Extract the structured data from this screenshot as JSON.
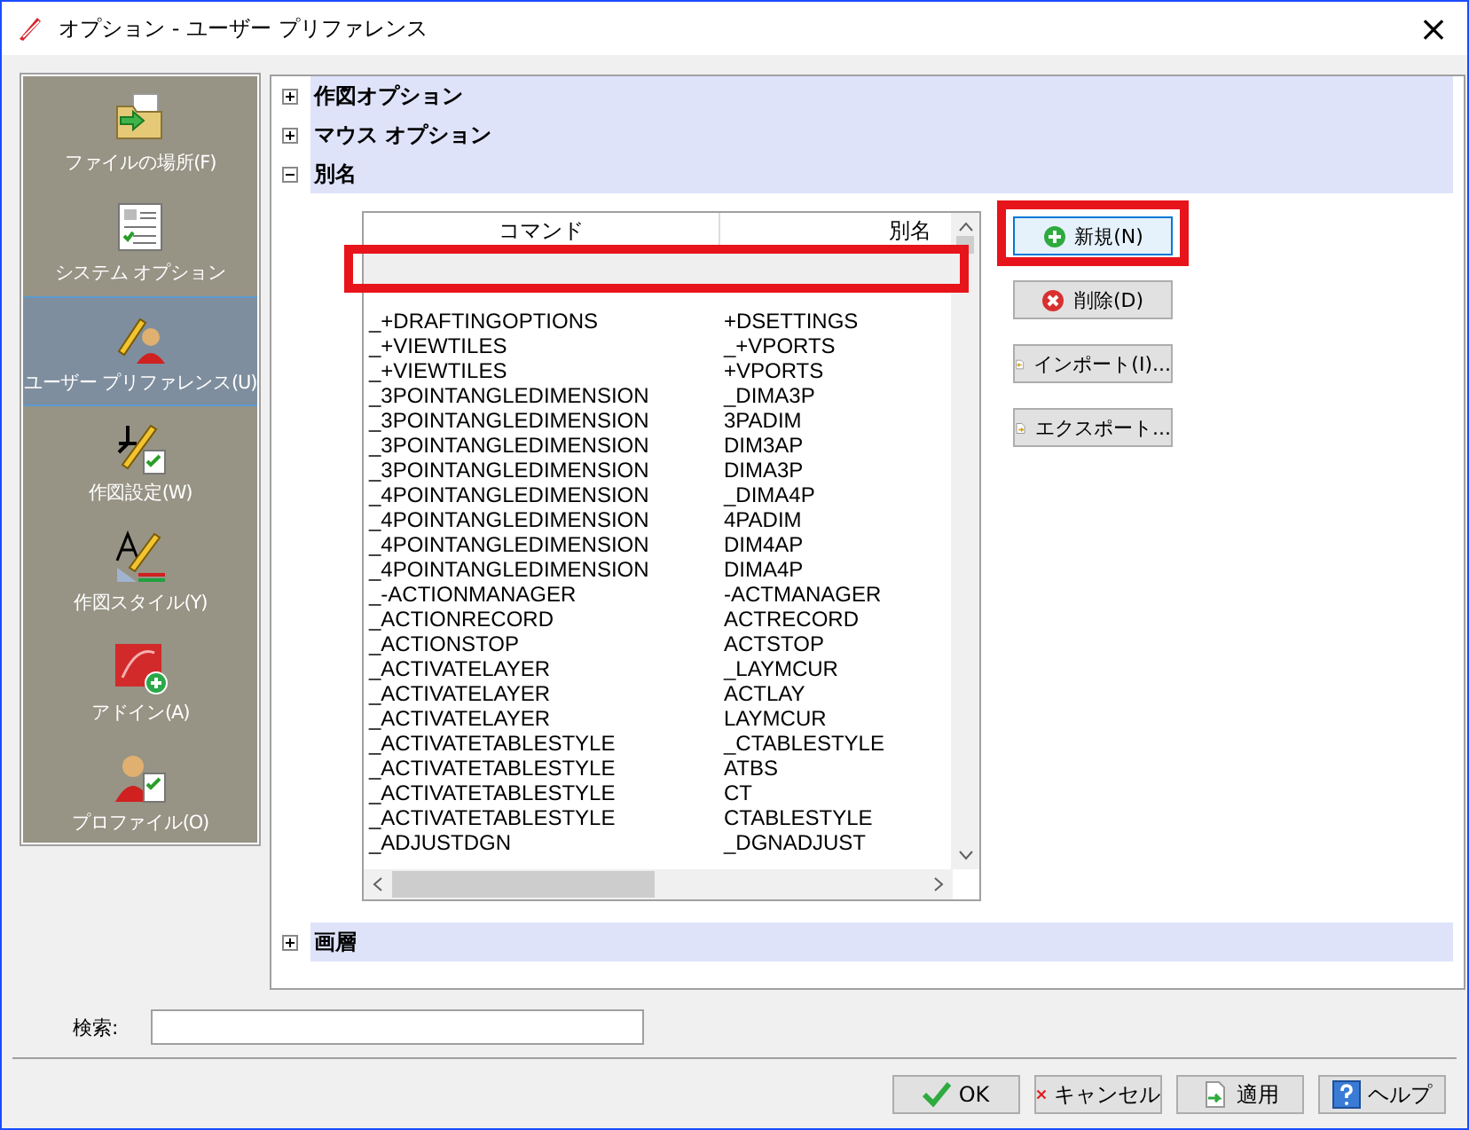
{
  "window": {
    "title": "オプション - ユーザー プリファレンス",
    "close": "×"
  },
  "sidebar": {
    "items": [
      {
        "label": "ファイルの場所(F)",
        "kind": "folder",
        "selected": false
      },
      {
        "label": "システム オプション",
        "kind": "system",
        "selected": false
      },
      {
        "label": "ユーザー プリファレンス(U)",
        "kind": "user",
        "selected": true
      },
      {
        "label": "作図設定(W)",
        "kind": "drafting",
        "selected": false
      },
      {
        "label": "作図スタイル(Y)",
        "kind": "style",
        "selected": false
      },
      {
        "label": "アドイン(A)",
        "kind": "addin",
        "selected": false
      },
      {
        "label": "プロファイル(O)",
        "kind": "profile",
        "selected": false
      }
    ]
  },
  "tree": [
    {
      "label": "作図オプション",
      "expanded": false
    },
    {
      "label": "マウス オプション",
      "expanded": false
    },
    {
      "label": "別名",
      "expanded": true
    },
    {
      "label": "画層",
      "expanded": false
    }
  ],
  "alias_table": {
    "columns": [
      "コマンド",
      "別名"
    ],
    "rows": [
      [
        "_+DRAFTINGOPTIONS",
        "+DSETTINGS"
      ],
      [
        "_+VIEWTILES",
        "_+VPORTS"
      ],
      [
        "_+VIEWTILES",
        "+VPORTS"
      ],
      [
        "_3POINTANGLEDIMENSION",
        "_DIMA3P"
      ],
      [
        "_3POINTANGLEDIMENSION",
        "3PADIM"
      ],
      [
        "_3POINTANGLEDIMENSION",
        "DIM3AP"
      ],
      [
        "_3POINTANGLEDIMENSION",
        "DIMA3P"
      ],
      [
        "_4POINTANGLEDIMENSION",
        "_DIMA4P"
      ],
      [
        "_4POINTANGLEDIMENSION",
        "4PADIM"
      ],
      [
        "_4POINTANGLEDIMENSION",
        "DIM4AP"
      ],
      [
        "_4POINTANGLEDIMENSION",
        "DIMA4P"
      ],
      [
        "_-ACTIONMANAGER",
        "-ACTMANAGER"
      ],
      [
        "_ACTIONRECORD",
        "ACTRECORD"
      ],
      [
        "_ACTIONSTOP",
        "ACTSTOP"
      ],
      [
        "_ACTIVATELAYER",
        "_LAYMCUR"
      ],
      [
        "_ACTIVATELAYER",
        "ACTLAY"
      ],
      [
        "_ACTIVATELAYER",
        "LAYMCUR"
      ],
      [
        "_ACTIVATETABLESTYLE",
        "_CTABLESTYLE"
      ],
      [
        "_ACTIVATETABLESTYLE",
        "ATBS"
      ],
      [
        "_ACTIVATETABLESTYLE",
        "CT"
      ],
      [
        "_ACTIVATETABLESTYLE",
        "CTABLESTYLE"
      ],
      [
        "_ADJUSTDGN",
        "_DGNADJUST"
      ]
    ]
  },
  "alias_buttons": [
    {
      "label": "新規(N)",
      "kind": "new"
    },
    {
      "label": "削除(D)",
      "kind": "delete"
    },
    {
      "label": "インポート(I)...",
      "kind": "import"
    },
    {
      "label": "エクスポート...",
      "kind": "export"
    }
  ],
  "search": {
    "label": "検索:"
  },
  "footer_buttons": [
    {
      "label": "OK",
      "kind": "ok"
    },
    {
      "label": "キャンセル",
      "kind": "cancel"
    },
    {
      "label": "適用",
      "kind": "apply"
    },
    {
      "label": "ヘルプ",
      "kind": "help"
    }
  ]
}
